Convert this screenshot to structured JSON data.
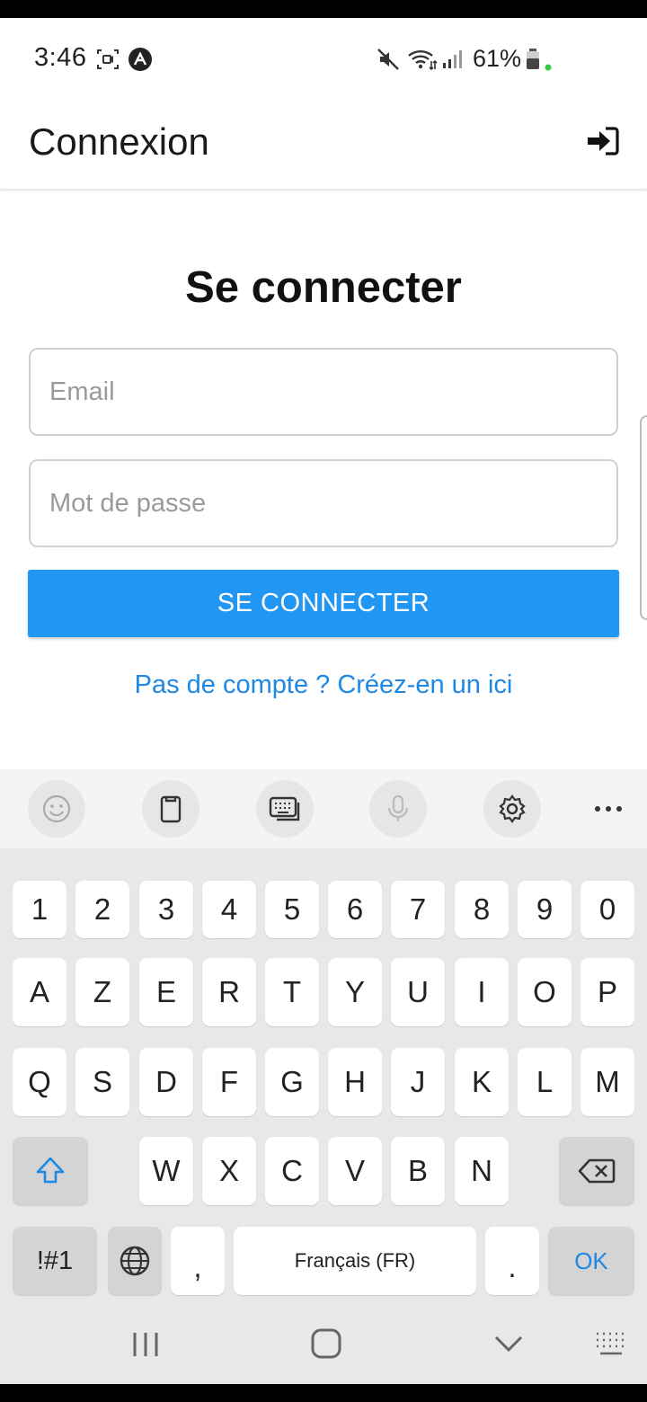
{
  "status_bar": {
    "time": "3:46",
    "battery": "61%",
    "icons": [
      "screen-record-icon",
      "app-a-icon",
      "mute-icon",
      "wifi-icon",
      "signal-icon",
      "battery-icon",
      "green-dot-icon"
    ]
  },
  "header": {
    "title": "Connexion",
    "action_icon": "login-icon"
  },
  "form": {
    "heading": "Se connecter",
    "email_placeholder": "Email",
    "password_placeholder": "Mot de passe",
    "submit_label": "SE CONNECTER",
    "signup_link": "Pas de compte ? Créez-en un ici"
  },
  "keyboard": {
    "toolbar_icons": [
      "emoji-icon",
      "clipboard-icon",
      "keyboard-mode-icon",
      "microphone-icon",
      "settings-icon",
      "more-icon"
    ],
    "row_numbers": [
      "1",
      "2",
      "3",
      "4",
      "5",
      "6",
      "7",
      "8",
      "9",
      "0"
    ],
    "row1": [
      "A",
      "Z",
      "E",
      "R",
      "T",
      "Y",
      "U",
      "I",
      "O",
      "P"
    ],
    "row2": [
      "Q",
      "S",
      "D",
      "F",
      "G",
      "H",
      "J",
      "K",
      "L",
      "M"
    ],
    "row3": [
      "W",
      "X",
      "C",
      "V",
      "B",
      "N"
    ],
    "symbols_label": "!#1",
    "comma": ",",
    "space_label": "Français (FR)",
    "period": ".",
    "ok_label": "OK"
  },
  "nav_bar": {
    "icons": [
      "recent-apps-icon",
      "home-icon",
      "back-icon",
      "keyboard-hide-icon"
    ]
  },
  "colors": {
    "accent": "#2196f3",
    "link": "#1e88e5",
    "keyboard_bg": "#e8e8e8"
  }
}
